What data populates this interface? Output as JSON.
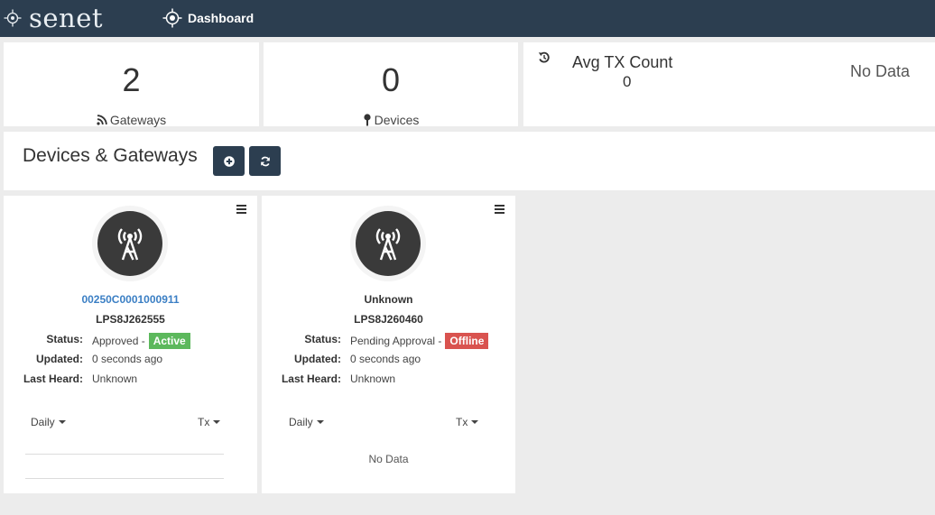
{
  "navbar": {
    "brand": "senet",
    "nav_item": "Dashboard"
  },
  "stats": {
    "gateways": {
      "value": "2",
      "label": "Gateways",
      "icon": "rss-icon"
    },
    "devices": {
      "value": "0",
      "label": "Devices",
      "icon": "map-pin-icon"
    },
    "avg_tx": {
      "title": "Avg TX Count",
      "value": "0",
      "status": "No Data",
      "icon": "history-icon"
    }
  },
  "section": {
    "title": "Devices & Gateways",
    "add_icon": "plus-circle-icon",
    "refresh_icon": "refresh-icon"
  },
  "cards": [
    {
      "name": "00250C0001000911",
      "model": "LPS8J262555",
      "status_label": "Status:",
      "status_text": "Approved -",
      "status_badge": "Active",
      "updated_label": "Updated:",
      "updated": "0 seconds ago",
      "last_heard_label": "Last Heard:",
      "last_heard": "Unknown",
      "period": "Daily",
      "metric": "Tx"
    },
    {
      "name": "Unknown",
      "model": "LPS8J260460",
      "status_label": "Status:",
      "status_text": "Pending Approval -",
      "status_badge": "Offline",
      "updated_label": "Updated:",
      "updated": "0 seconds ago",
      "last_heard_label": "Last Heard:",
      "last_heard": "Unknown",
      "period": "Daily",
      "metric": "Tx",
      "chart_status": "No Data"
    }
  ],
  "colors": {
    "navbar": "#2c3e50",
    "link": "#3b7fc4",
    "active": "#5cb85c",
    "offline": "#d9534f"
  }
}
